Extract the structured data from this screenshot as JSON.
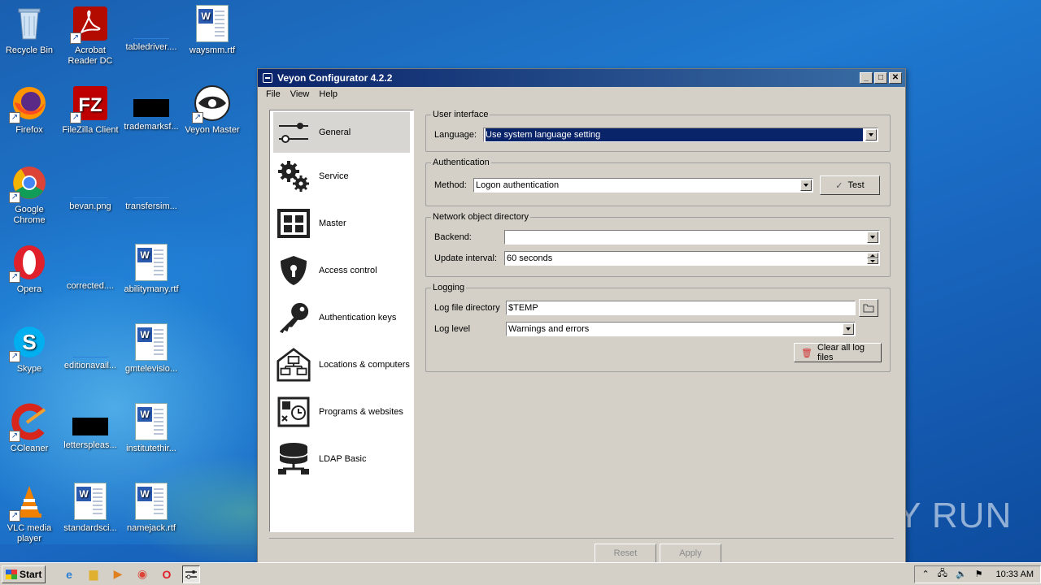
{
  "desktop_icons": [
    {
      "label": "Recycle Bin",
      "icon": "recycle-bin-icon"
    },
    {
      "label": "Acrobat Reader DC",
      "icon": "acrobat-icon"
    },
    {
      "label": "tabledriver....",
      "icon": "file-icon"
    },
    {
      "label": "waysmm.rtf",
      "icon": "word-doc-icon"
    },
    {
      "label": "Firefox",
      "icon": "firefox-icon"
    },
    {
      "label": "FileZilla Client",
      "icon": "filezilla-icon"
    },
    {
      "label": "trademarksf...",
      "icon": "file-icon"
    },
    {
      "label": "Veyon Master",
      "icon": "veyon-icon"
    },
    {
      "label": "Google Chrome",
      "icon": "chrome-icon"
    },
    {
      "label": "bevan.png",
      "icon": "file-icon"
    },
    {
      "label": "transfersim...",
      "icon": "file-icon"
    },
    {
      "label": "Opera",
      "icon": "opera-icon"
    },
    {
      "label": "corrected....",
      "icon": "file-icon"
    },
    {
      "label": "abilitymany.rtf",
      "icon": "word-doc-icon"
    },
    {
      "label": "Skype",
      "icon": "skype-icon"
    },
    {
      "label": "editionavail...",
      "icon": "file-icon"
    },
    {
      "label": "gmtelevisio...",
      "icon": "word-doc-icon"
    },
    {
      "label": "CCleaner",
      "icon": "ccleaner-icon"
    },
    {
      "label": "letterspleas...",
      "icon": "file-icon"
    },
    {
      "label": "institutethir...",
      "icon": "word-doc-icon"
    },
    {
      "label": "VLC media player",
      "icon": "vlc-icon"
    },
    {
      "label": "standardsci...",
      "icon": "word-doc-icon"
    },
    {
      "label": "namejack.rtf",
      "icon": "word-doc-icon"
    }
  ],
  "window": {
    "title": "Veyon Configurator 4.2.2",
    "menu": [
      "File",
      "View",
      "Help"
    ],
    "nav": [
      {
        "label": "General",
        "icon": "sliders-icon",
        "active": true
      },
      {
        "label": "Service",
        "icon": "gears-icon"
      },
      {
        "label": "Master",
        "icon": "grid-icon"
      },
      {
        "label": "Access control",
        "icon": "shield-icon"
      },
      {
        "label": "Authentication keys",
        "icon": "key-icon"
      },
      {
        "label": "Locations & computers",
        "icon": "network-icon"
      },
      {
        "label": "Programs & websites",
        "icon": "programs-icon"
      },
      {
        "label": "LDAP Basic",
        "icon": "database-icon"
      }
    ],
    "user_interface": {
      "legend": "User interface",
      "language_label": "Language:",
      "language_value": "Use system language setting"
    },
    "authentication": {
      "legend": "Authentication",
      "method_label": "Method:",
      "method_value": "Logon authentication",
      "test_button": "Test"
    },
    "network": {
      "legend": "Network object directory",
      "backend_label": "Backend:",
      "backend_value": "",
      "interval_label": "Update interval:",
      "interval_value": "60 seconds"
    },
    "logging": {
      "legend": "Logging",
      "dir_label": "Log file directory",
      "dir_value": "$TEMP",
      "level_label": "Log level",
      "level_value": "Warnings and errors",
      "clear_button": "Clear all log files"
    },
    "reset_button": "Reset",
    "apply_button": "Apply"
  },
  "watermark": "ANY RUN",
  "taskbar": {
    "start_label": "Start",
    "clock": "10:33 AM"
  }
}
